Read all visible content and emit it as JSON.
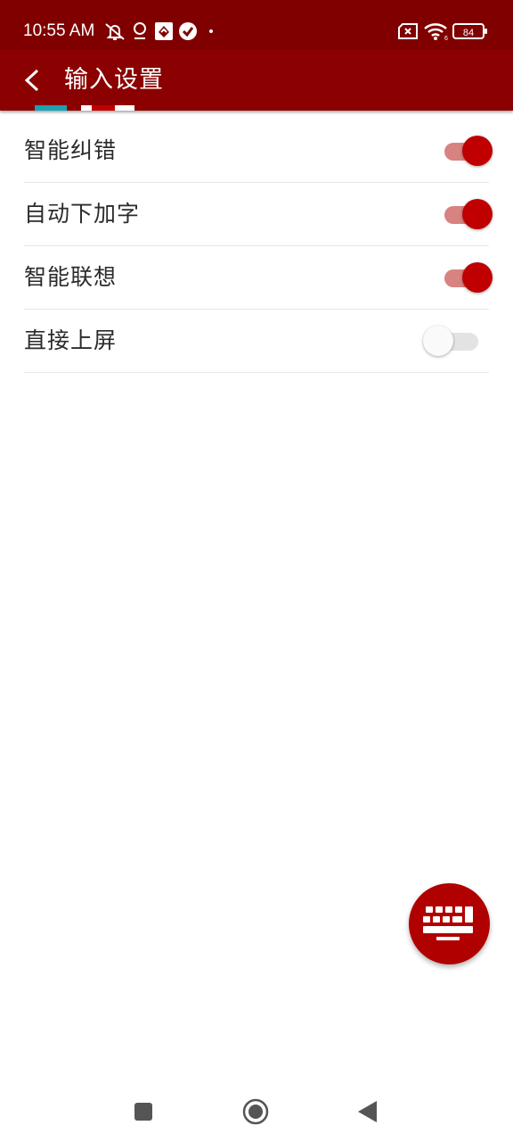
{
  "status_bar": {
    "time": "10:55 AM",
    "battery_level": "84",
    "icons": [
      "mute-icon",
      "location-pin-icon",
      "app-notification-icon",
      "check-circle-icon",
      "dot-icon",
      "sim-off-icon",
      "wifi-icon",
      "battery-icon"
    ]
  },
  "app_bar": {
    "title": "输入设置",
    "back_icon": "back-arrow-icon"
  },
  "settings": [
    {
      "label": "智能纠错",
      "enabled": true
    },
    {
      "label": "自动下加字",
      "enabled": true
    },
    {
      "label": "智能联想",
      "enabled": true
    },
    {
      "label": "直接上屏",
      "enabled": false
    }
  ],
  "fab": {
    "icon": "keyboard-icon"
  },
  "nav_bar": {
    "icons": [
      "recent-apps-icon",
      "home-icon",
      "back-icon"
    ]
  },
  "colors": {
    "status_bar": "#800000",
    "app_bar": "#8b0000",
    "accent": "#c00000",
    "accent_track": "#d98282",
    "fab": "#b00000"
  }
}
